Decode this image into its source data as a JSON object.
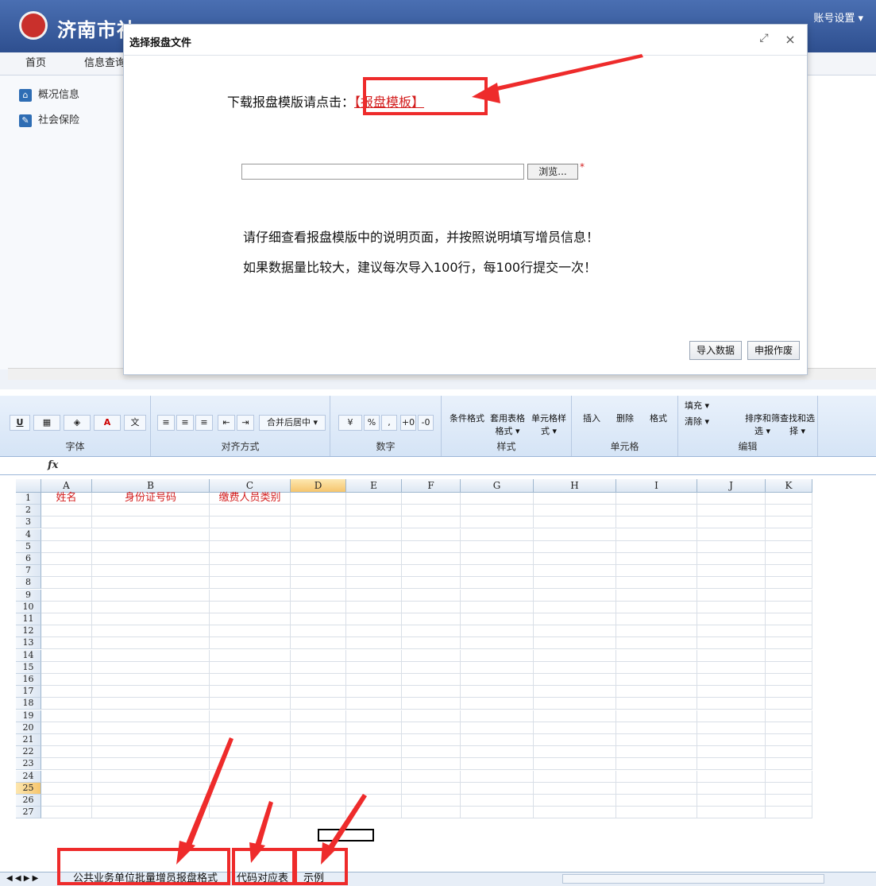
{
  "portal": {
    "site_title": "济南市社",
    "account_label": "账号设置 ▾",
    "nav": [
      "首页",
      "信息查询"
    ],
    "sidebar": [
      "概况信息",
      "社会保险"
    ]
  },
  "dialog": {
    "title": "选择报盘文件",
    "download_prefix": "下载报盘模版请点击：",
    "download_link": "【报盘模板】",
    "file_value": "",
    "browse_label": "浏览...",
    "required_mark": "*",
    "tip1": "请仔细查看报盘模版中的说明页面，并按照说明填写增员信息！",
    "tip2": "如果数据量比较大，建议每次导入100行，每100行提交一次！",
    "import_label": "导入数据",
    "cancel_label": "申报作废"
  },
  "ribbon": {
    "groups": [
      {
        "label": "字体"
      },
      {
        "label": "对齐方式",
        "merge": "合并后居中 ▾"
      },
      {
        "label": "数字",
        "percent": "%",
        "comma": ","
      },
      {
        "label": "样式",
        "items": [
          "条件格式",
          "套用表格格式 ▾",
          "单元格样式 ▾"
        ]
      },
      {
        "label": "单元格",
        "items": [
          "插入",
          "删除",
          "格式"
        ]
      },
      {
        "label": "编辑",
        "items": [
          "填充 ▾",
          "清除 ▾",
          "排序和筛选 ▾",
          "查找和选择 ▾"
        ]
      }
    ]
  },
  "sheet": {
    "columns": [
      "A",
      "B",
      "C",
      "D",
      "E",
      "F",
      "G",
      "H",
      "I",
      "J",
      "K"
    ],
    "active_column": "D",
    "active_row": "25",
    "header_row": [
      "姓名",
      "身份证号码",
      "缴费人员类别"
    ],
    "rows": [
      "1",
      "2",
      "3",
      "4",
      "5",
      "6",
      "7",
      "8",
      "9",
      "10",
      "11",
      "12",
      "13",
      "14",
      "15",
      "16",
      "17",
      "18",
      "19",
      "20",
      "21",
      "22",
      "23",
      "24",
      "25",
      "26",
      "27"
    ],
    "tabs": [
      "公共业务单位批量增员报盘格式",
      "代码对应表",
      "示例"
    ],
    "nav_arrows": "◀ ◀ ▶ ▶"
  },
  "accent": "#ee2b2b"
}
